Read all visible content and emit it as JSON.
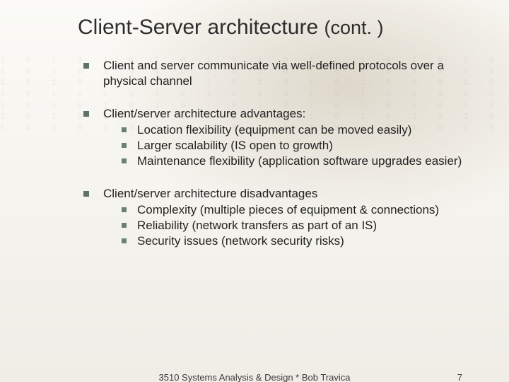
{
  "title_main": "Client-Server architecture",
  "title_cont": "(cont. )",
  "bullets": [
    {
      "text": "Client and server communicate via well-defined protocols over a physical channel",
      "sub": []
    },
    {
      "text": "Client/server architecture advantages:",
      "sub": [
        "Location flexibility (equipment can be moved easily)",
        "Larger scalability (IS open to growth)",
        "Maintenance flexibility (application software upgrades easier)"
      ]
    },
    {
      "text": "Client/server architecture disadvantages",
      "sub": [
        "Complexity (multiple pieces of equipment & connections)",
        "Reliability (network transfers as part of an IS)",
        "Security issues (network security risks)"
      ]
    }
  ],
  "footer": {
    "course": "3510 Systems Analysis & Design * Bob Travica",
    "page": "7"
  },
  "texture_row": "1 0 1 0 1 0 1 0 1 0 1 0 1 0 1 0 1 0 1 0 1 0 1 0 1 0 1 0 1 0 1 0 1 0 1 0 1 0 1 0 1 0 1 0"
}
